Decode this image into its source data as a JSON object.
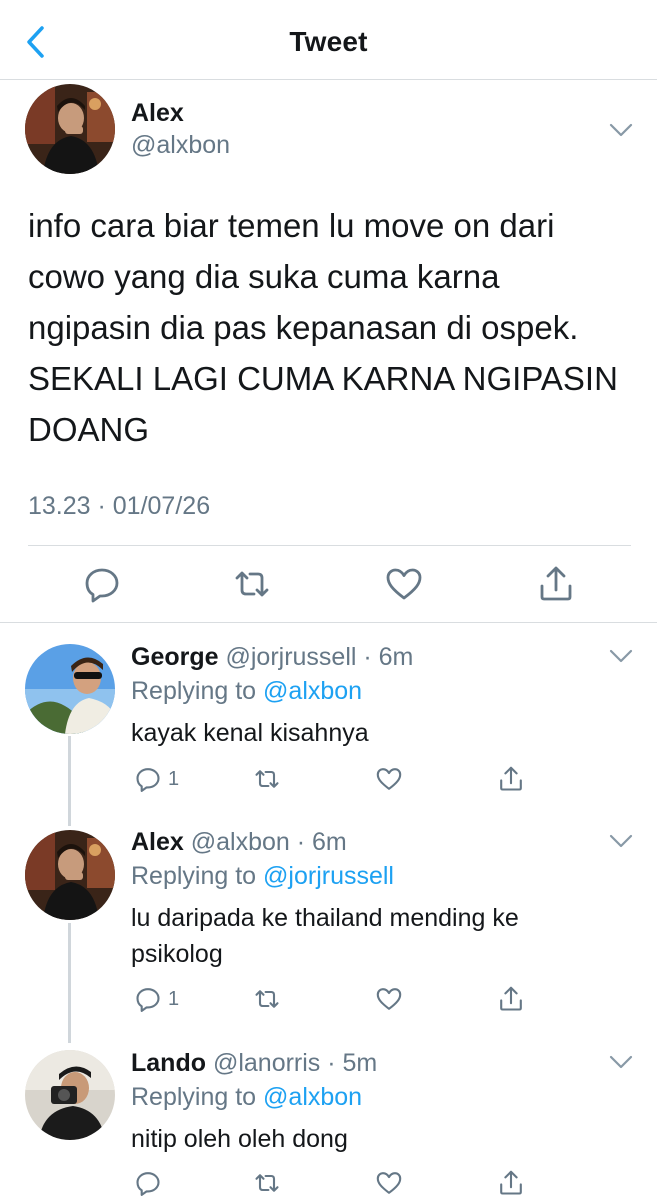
{
  "nav": {
    "title": "Tweet",
    "back_icon": "chevron-left-icon",
    "accent_color": "#1da1f2"
  },
  "main_tweet": {
    "name": "Alex",
    "handle": "@alxbon",
    "text_lines": [
      "info cara biar temen lu move on dari",
      "cowo yang dia suka cuma karna",
      "ngipasin dia pas kepanasan di ospek.",
      "SEKALI LAGI CUMA KARNA NGIPASIN",
      "DOANG"
    ],
    "timestamp": "13.23 · 01/07/26",
    "actions": [
      "reply-icon",
      "retweet-icon",
      "like-icon",
      "share-icon"
    ]
  },
  "replies": [
    {
      "name": "George",
      "meta": "@jorjrussell · 6m",
      "replying_prefix": "Replying to ",
      "replying_to": "@alxbon",
      "text_lines": [
        "kayak kenal kisahnya"
      ],
      "reply_count": "1"
    },
    {
      "name": "Alex",
      "meta": "@alxbon · 6m",
      "replying_prefix": "Replying to ",
      "replying_to": "@jorjrussell",
      "text_lines": [
        "lu daripada ke thailand mending ke",
        "psikolog"
      ],
      "reply_count": "1"
    },
    {
      "name": "Lando",
      "meta": "@lanorris · 5m",
      "replying_prefix": "Replying to ",
      "replying_to": "@alxbon",
      "text_lines": [
        "nitip oleh oleh dong"
      ],
      "reply_count": ""
    }
  ]
}
